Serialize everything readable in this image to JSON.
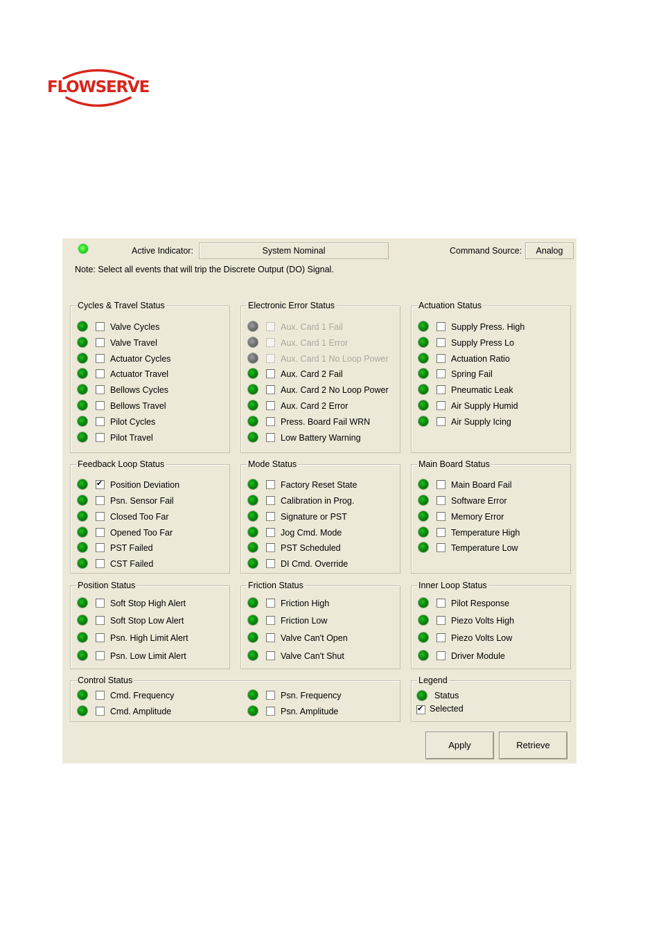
{
  "brand": {
    "name": "FLOWSERVE",
    "color": "#d9251c"
  },
  "header": {
    "active_indicator_label": "Active Indicator:",
    "active_indicator_value": "System Nominal",
    "command_source_label": "Command Source:",
    "command_source_value": "Analog",
    "note": "Note: Select all events that will trip the Discrete Output (DO) Signal."
  },
  "groups": {
    "cycles": {
      "title": "Cycles & Travel Status",
      "items": [
        {
          "label": "Valve Cycles"
        },
        {
          "label": "Valve Travel"
        },
        {
          "label": "Actuator Cycles"
        },
        {
          "label": "Actuator Travel"
        },
        {
          "label": "Bellows Cycles"
        },
        {
          "label": "Bellows Travel"
        },
        {
          "label": "Pilot Cycles"
        },
        {
          "label": "Pilot Travel"
        }
      ]
    },
    "electronic": {
      "title": "Electronic Error Status",
      "items": [
        {
          "label": "Aux. Card 1 Fail",
          "disabled": true
        },
        {
          "label": "Aux. Card 1 Error",
          "disabled": true
        },
        {
          "label": "Aux. Card 1 No Loop Power",
          "disabled": true
        },
        {
          "label": "Aux. Card 2 Fail"
        },
        {
          "label": "Aux. Card 2 No Loop Power"
        },
        {
          "label": "Aux. Card 2 Error"
        },
        {
          "label": "Press. Board Fail WRN"
        },
        {
          "label": "Low Battery Warning"
        }
      ]
    },
    "actuation": {
      "title": "Actuation Status",
      "items": [
        {
          "label": "Supply Press. High"
        },
        {
          "label": "Supply Press Lo"
        },
        {
          "label": "Actuation Ratio"
        },
        {
          "label": "Spring Fail"
        },
        {
          "label": "Pneumatic Leak"
        },
        {
          "label": "Air Supply Humid"
        },
        {
          "label": "Air Supply Icing"
        }
      ]
    },
    "feedback": {
      "title": "Feedback Loop Status",
      "items": [
        {
          "label": "Position Deviation",
          "checked": true
        },
        {
          "label": "Psn. Sensor Fail"
        },
        {
          "label": "Closed Too Far"
        },
        {
          "label": "Opened Too Far"
        },
        {
          "label": "PST Failed"
        },
        {
          "label": "CST Failed"
        }
      ]
    },
    "mode": {
      "title": "Mode Status",
      "items": [
        {
          "label": "Factory Reset State"
        },
        {
          "label": "Calibration in Prog."
        },
        {
          "label": "Signature or PST"
        },
        {
          "label": "Jog Cmd. Mode"
        },
        {
          "label": "PST Scheduled"
        },
        {
          "label": "DI Cmd. Override"
        }
      ]
    },
    "mainboard": {
      "title": "Main Board Status",
      "items": [
        {
          "label": "Main Board Fail"
        },
        {
          "label": "Software Error"
        },
        {
          "label": "Memory Error"
        },
        {
          "label": "Temperature High"
        },
        {
          "label": "Temperature Low"
        }
      ]
    },
    "position": {
      "title": "Position Status",
      "items": [
        {
          "label": "Soft Stop High Alert"
        },
        {
          "label": "Soft Stop Low Alert"
        },
        {
          "label": "Psn. High Limit Alert"
        },
        {
          "label": "Psn. Low Limit Alert"
        }
      ]
    },
    "friction": {
      "title": "Friction Status",
      "items": [
        {
          "label": "Friction High"
        },
        {
          "label": "Friction Low"
        },
        {
          "label": "Valve Can't Open"
        },
        {
          "label": "Valve Can't Shut"
        }
      ]
    },
    "innerloop": {
      "title": "Inner Loop Status",
      "items": [
        {
          "label": "Pilot Response"
        },
        {
          "label": "Piezo Volts High"
        },
        {
          "label": "Piezo Volts Low"
        },
        {
          "label": "Driver Module"
        }
      ]
    },
    "control": {
      "title": "Control Status",
      "items": [
        {
          "label": "Cmd. Frequency"
        },
        {
          "label": "Cmd. Amplitude"
        },
        {
          "label": "Psn. Frequency"
        },
        {
          "label": "Psn. Amplitude"
        }
      ]
    }
  },
  "legend": {
    "title": "Legend",
    "status_label": "Status",
    "selected_label": "Selected"
  },
  "buttons": {
    "apply": "Apply",
    "retrieve": "Retrieve"
  }
}
